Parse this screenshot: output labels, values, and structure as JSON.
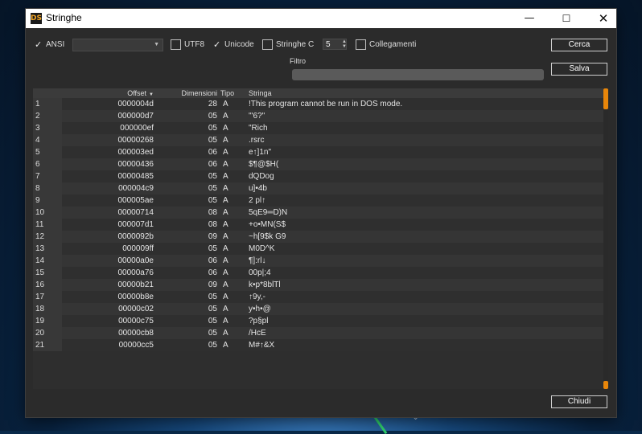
{
  "window": {
    "title": "Stringhe",
    "icon_text": "DS",
    "controls": {
      "minimize": "—",
      "maximize": "☐",
      "close": "✕"
    }
  },
  "options": {
    "ansi": {
      "label": "ANSI",
      "checked": true
    },
    "ansi_combo_value": "",
    "utf8": {
      "label": "UTF8",
      "checked": false
    },
    "unicode": {
      "label": "Unicode",
      "checked": true
    },
    "stringhe_c": {
      "label": "Stringhe C",
      "checked": false
    },
    "min_length": "5",
    "collegamenti": {
      "label": "Collegamenti",
      "checked": false
    }
  },
  "filter": {
    "label": "Filtro",
    "value": ""
  },
  "buttons": {
    "cerca": "Cerca",
    "salva": "Salva",
    "chiudi": "Chiudi"
  },
  "table": {
    "columns": {
      "offset": "Offset",
      "dimensioni": "Dimensioni",
      "tipo": "Tipo",
      "stringa": "Stringa"
    },
    "rows": [
      {
        "idx": "1",
        "offset": "0000004d",
        "dim": "28",
        "tipo": "A",
        "str": "!This program cannot be run in DOS mode."
      },
      {
        "idx": "2",
        "offset": "000000d7",
        "dim": "05",
        "tipo": "A",
        "str": "\"'6?\""
      },
      {
        "idx": "3",
        "offset": "000000ef",
        "dim": "05",
        "tipo": "A",
        "str": "\"Rich"
      },
      {
        "idx": "4",
        "offset": "00000268",
        "dim": "05",
        "tipo": "A",
        "str": ".rsrc"
      },
      {
        "idx": "5",
        "offset": "000003ed",
        "dim": "06",
        "tipo": "A",
        "str": "e↑]1n\""
      },
      {
        "idx": "6",
        "offset": "00000436",
        "dim": "06",
        "tipo": "A",
        "str": "$¶@$H("
      },
      {
        "idx": "7",
        "offset": "00000485",
        "dim": "05",
        "tipo": "A",
        "str": "dQDog"
      },
      {
        "idx": "8",
        "offset": "000004c9",
        "dim": "05",
        "tipo": "A",
        "str": "u]•4b"
      },
      {
        "idx": "9",
        "offset": "000005ae",
        "dim": "05",
        "tipo": "A",
        "str": "2 pl↑"
      },
      {
        "idx": "10",
        "offset": "00000714",
        "dim": "08",
        "tipo": "A",
        "str": "5qE9═D)N"
      },
      {
        "idx": "11",
        "offset": "000007d1",
        "dim": "08",
        "tipo": "A",
        "str": "+o•MN(S$"
      },
      {
        "idx": "12",
        "offset": "0000092b",
        "dim": "09",
        "tipo": "A",
        "str": "~h[9$k G9"
      },
      {
        "idx": "13",
        "offset": "000009ff",
        "dim": "05",
        "tipo": "A",
        "str": "M0D^K"
      },
      {
        "idx": "14",
        "offset": "00000a0e",
        "dim": "06",
        "tipo": "A",
        "str": "¶]:rl↓"
      },
      {
        "idx": "15",
        "offset": "00000a76",
        "dim": "06",
        "tipo": "A",
        "str": "00p|;4"
      },
      {
        "idx": "16",
        "offset": "00000b21",
        "dim": "09",
        "tipo": "A",
        "str": "k•p*8blTl"
      },
      {
        "idx": "17",
        "offset": "00000b8e",
        "dim": "05",
        "tipo": "A",
        "str": "↑9y,-"
      },
      {
        "idx": "18",
        "offset": "00000c02",
        "dim": "05",
        "tipo": "A",
        "str": "y•h•@"
      },
      {
        "idx": "19",
        "offset": "00000c75",
        "dim": "05",
        "tipo": "A",
        "str": "?p§pl"
      },
      {
        "idx": "20",
        "offset": "00000cb8",
        "dim": "05",
        "tipo": "A",
        "str": "/HcE"
      },
      {
        "idx": "21",
        "offset": "00000cc5",
        "dim": "05",
        "tipo": "A",
        "str": "M#↑&X"
      }
    ]
  },
  "colors": {
    "accent": "#e8860a",
    "panel": "#2b2b2b",
    "titlebar": "#ffffff"
  }
}
